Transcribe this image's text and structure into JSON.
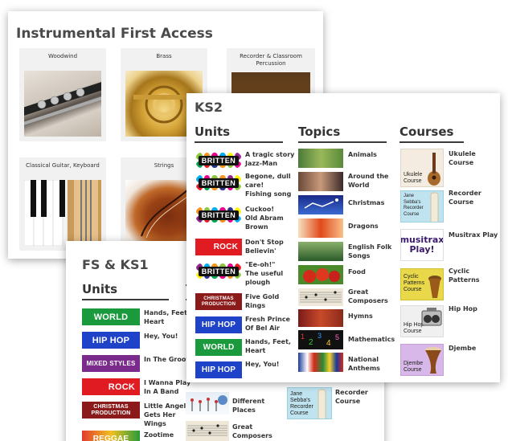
{
  "instrumental": {
    "title": "Instrumental First Access",
    "cards": [
      "Woodwind",
      "Brass",
      "Recorder & Classroom\nPercussion",
      "Classical Guitar, Keyboard",
      "Strings"
    ]
  },
  "fsks1": {
    "title": "FS & KS1",
    "units_heading": "Units",
    "topics_heading_partial": "To",
    "units": [
      {
        "badge": "WORLD",
        "label": "Hands, Feet,\nHeart"
      },
      {
        "badge": "HIP HOP",
        "label": "Hey, You!"
      },
      {
        "badge": "MIXED STYLES",
        "label": "In The Groove"
      },
      {
        "badge": "ROCK",
        "label": "I Wanna Play\nIn A Band"
      },
      {
        "badge": "CHRISTMAS\nPRODUCTION",
        "label": "Little Angel\nGets Her\nWings"
      },
      {
        "badge": "REGGAE",
        "label": "Zootime"
      }
    ],
    "topics": [
      {
        "label": "Different\nPlaces"
      },
      {
        "label": "Great\nComposers"
      }
    ],
    "courses": [
      {
        "label": "Recorder\nCourse",
        "caption": "Jane\nSebba's\nRecorder\nCourse"
      }
    ]
  },
  "ks2": {
    "title": "KS2",
    "units_heading": "Units",
    "topics_heading": "Topics",
    "courses_heading": "Courses",
    "units": [
      {
        "badge": "BRITTEN",
        "label": "A tragic story\nJazz-Man"
      },
      {
        "badge": "BRITTEN",
        "label": "Begone, dull\ncare!\nFishing song"
      },
      {
        "badge": "BRITTEN",
        "label": "Cuckoo!\nOld Abram\nBrown"
      },
      {
        "badge": "ROCK",
        "label": "Don't Stop\nBelievin'"
      },
      {
        "badge": "BRITTEN",
        "label": "\"Ee-oh!\"\nThe useful\nplough"
      },
      {
        "badge": "CHRISTMAS\nPRODUCTION",
        "label": "Five Gold\nRings"
      },
      {
        "badge": "HIP HOP",
        "label": "Fresh Prince\nOf Bel Air"
      },
      {
        "badge": "WORLD",
        "label": "Hands, Feet,\nHeart"
      },
      {
        "badge": "HIP HOP",
        "label": "Hey, You!"
      }
    ],
    "topics": [
      {
        "label": "Animals"
      },
      {
        "label": "Around the\nWorld"
      },
      {
        "label": "Christmas"
      },
      {
        "label": "Dragons"
      },
      {
        "label": "English Folk\nSongs"
      },
      {
        "label": "Food"
      },
      {
        "label": "Great\nComposers"
      },
      {
        "label": "Hymns"
      },
      {
        "label": "Mathematics"
      },
      {
        "label": "National\nAnthems"
      }
    ],
    "courses": [
      {
        "label": "Ukulele\nCourse",
        "caption": "Ukulele\nCourse"
      },
      {
        "label": "Recorder\nCourse",
        "caption": "Jane\nSebba's\nRecorder\nCourse"
      },
      {
        "label": "Musitrax Play",
        "caption": "musitrax\nPlay!"
      },
      {
        "label": "Cyclic\nPatterns",
        "caption": "Cyclic\nPatterns\nCourse"
      },
      {
        "label": "Hip Hop",
        "caption": "Hip Hop\nCourse"
      },
      {
        "label": "Djembe",
        "caption": "Djembe\nCourse"
      }
    ]
  },
  "colors": {
    "world": "#1a9a3c",
    "hiphop": "#1e43c8",
    "mixed": "#7a2b8c",
    "rock": "#e01b22",
    "christmas": "#8b1a1a",
    "reggae": "#e23a2f",
    "britten_bg": "#f2f2f2"
  }
}
